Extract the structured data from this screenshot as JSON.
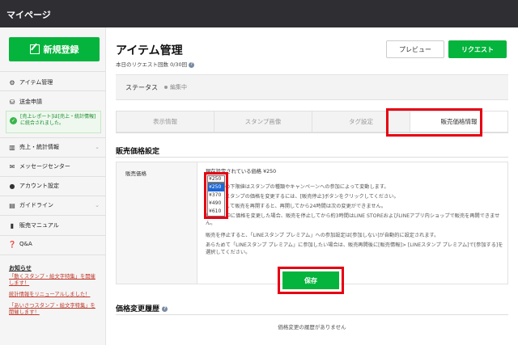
{
  "topbar": {
    "title": "マイページ"
  },
  "sidebar": {
    "new_button": "新規登録",
    "items": [
      {
        "label": "アイテム管理",
        "icon": "gear-icon"
      },
      {
        "label": "送金申請",
        "icon": "bank-icon"
      },
      {
        "label": "売上・統計情報",
        "icon": "chart-icon"
      },
      {
        "label": "メッセージセンター",
        "icon": "mail-icon"
      },
      {
        "label": "アカウント設定",
        "icon": "person-icon"
      },
      {
        "label": "ガイドライン",
        "icon": "book-icon"
      },
      {
        "label": "販売マニュアル",
        "icon": "document-icon"
      },
      {
        "label": "Q&A",
        "icon": "question-icon"
      }
    ],
    "alert_text": "[売上レポート]は[売上・統計情報]に統合されました。",
    "notice_title": "お知らせ",
    "notices": [
      "「動くスタンプ・絵文字特集」を開催します！",
      "統計情報をリニューアルしました！",
      "「あいさつスタンプ・絵文字特集」を開催します！"
    ]
  },
  "main": {
    "title": "アイテム管理",
    "quota": "本日のリクエスト回数 0/30回",
    "preview_button": "プレビュー",
    "request_button": "リクエスト",
    "status_label": "ステータス",
    "status_value": "編集中",
    "tabs": [
      {
        "label": "表示情報",
        "active": false
      },
      {
        "label": "スタンプ画像",
        "active": false
      },
      {
        "label": "タグ設定",
        "active": false
      },
      {
        "label": "販売価格情報",
        "active": true
      }
    ],
    "section_title": "販売価格設定",
    "price_label": "販売価格",
    "current_price": "現在設定されている価格 ¥250",
    "dropdown": {
      "selected": "¥250",
      "options": [
        "¥250",
        "¥370",
        "¥490",
        "¥610"
      ]
    },
    "texts": [
      "の下限値はスタンプの種類やキャンペーンへの参加によって変動します。",
      "スタンプの価格を変更するには、[販売停止]ボタンをクリックしてください。",
      "して販売を再開すると、再開してから24時間は次の変更ができません。",
      "販売停止中に価格を変更した場合、販売を停止してから約3時間はLINE STOREおよびLINEアプリ内ショップで販売を再開できません。",
      "販売を停止すると、「LINEスタンプ プレミアム」への参加設定は[参加しない]が自動的に設定されます。",
      "あらためて「LINEスタンプ プレミアム」に参加したい場合は、販売再開後に[販売情報]> [LINEスタンプ プレミアム]で[参加する]を選択してください。"
    ],
    "save_button": "保存",
    "history_title": "価格変更履歴",
    "history_empty": "価格変更の履歴がありません"
  },
  "colors": {
    "brand_green": "#04b43c",
    "highlight_red": "#e60012",
    "topbar": "#2e2e33"
  }
}
